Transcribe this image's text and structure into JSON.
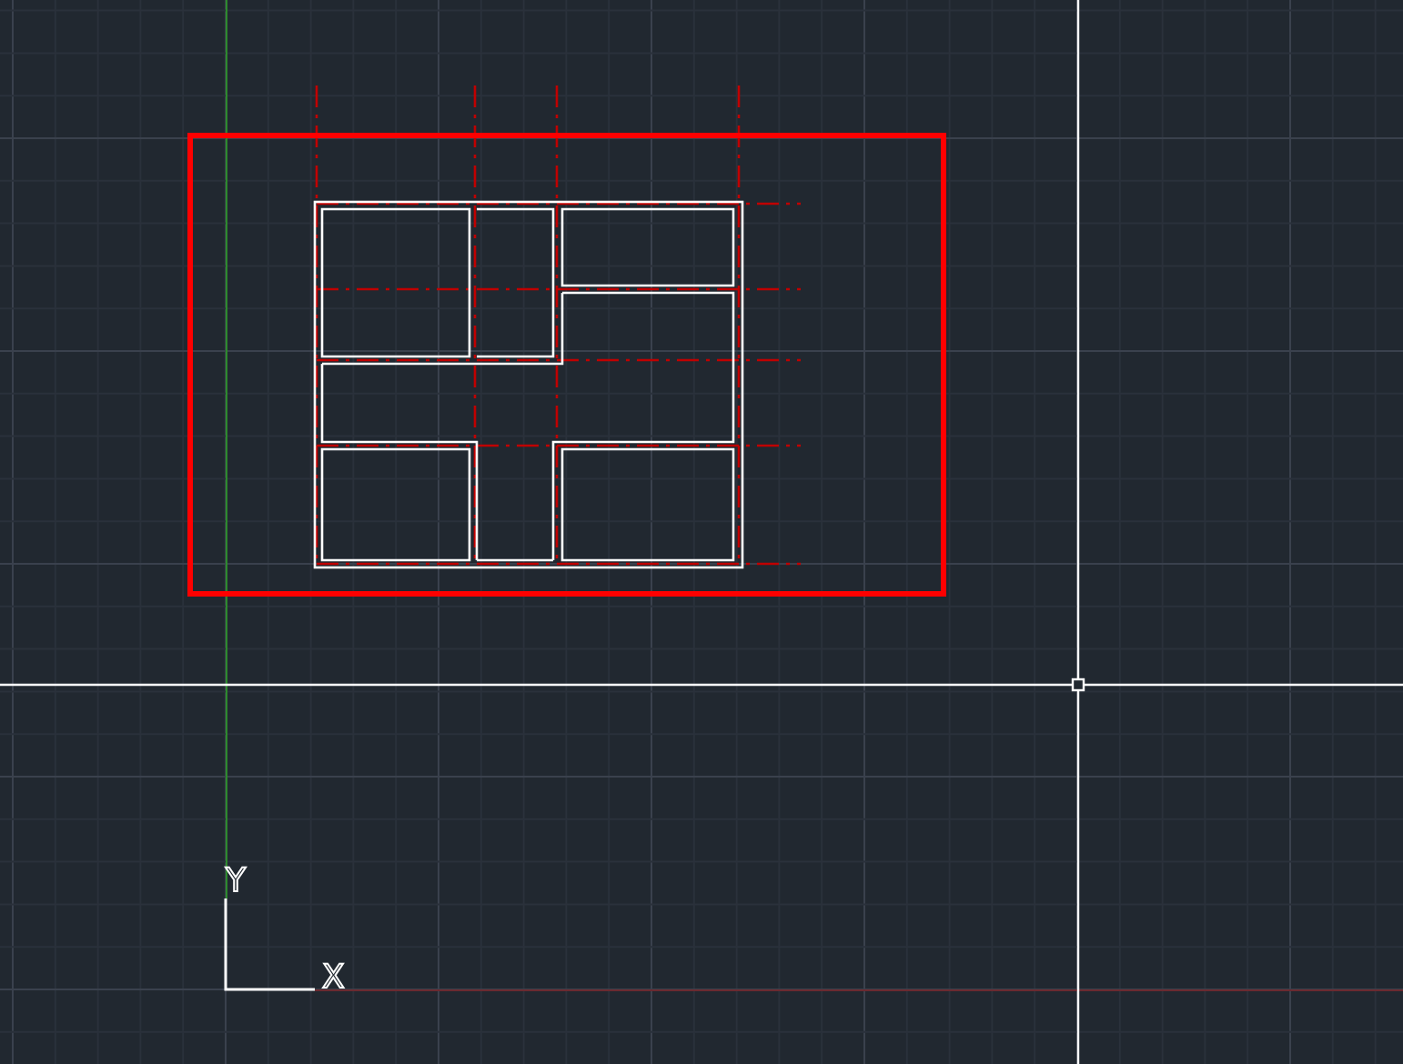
{
  "ucs_icon": {
    "y_label": "Y",
    "x_label": "X"
  }
}
